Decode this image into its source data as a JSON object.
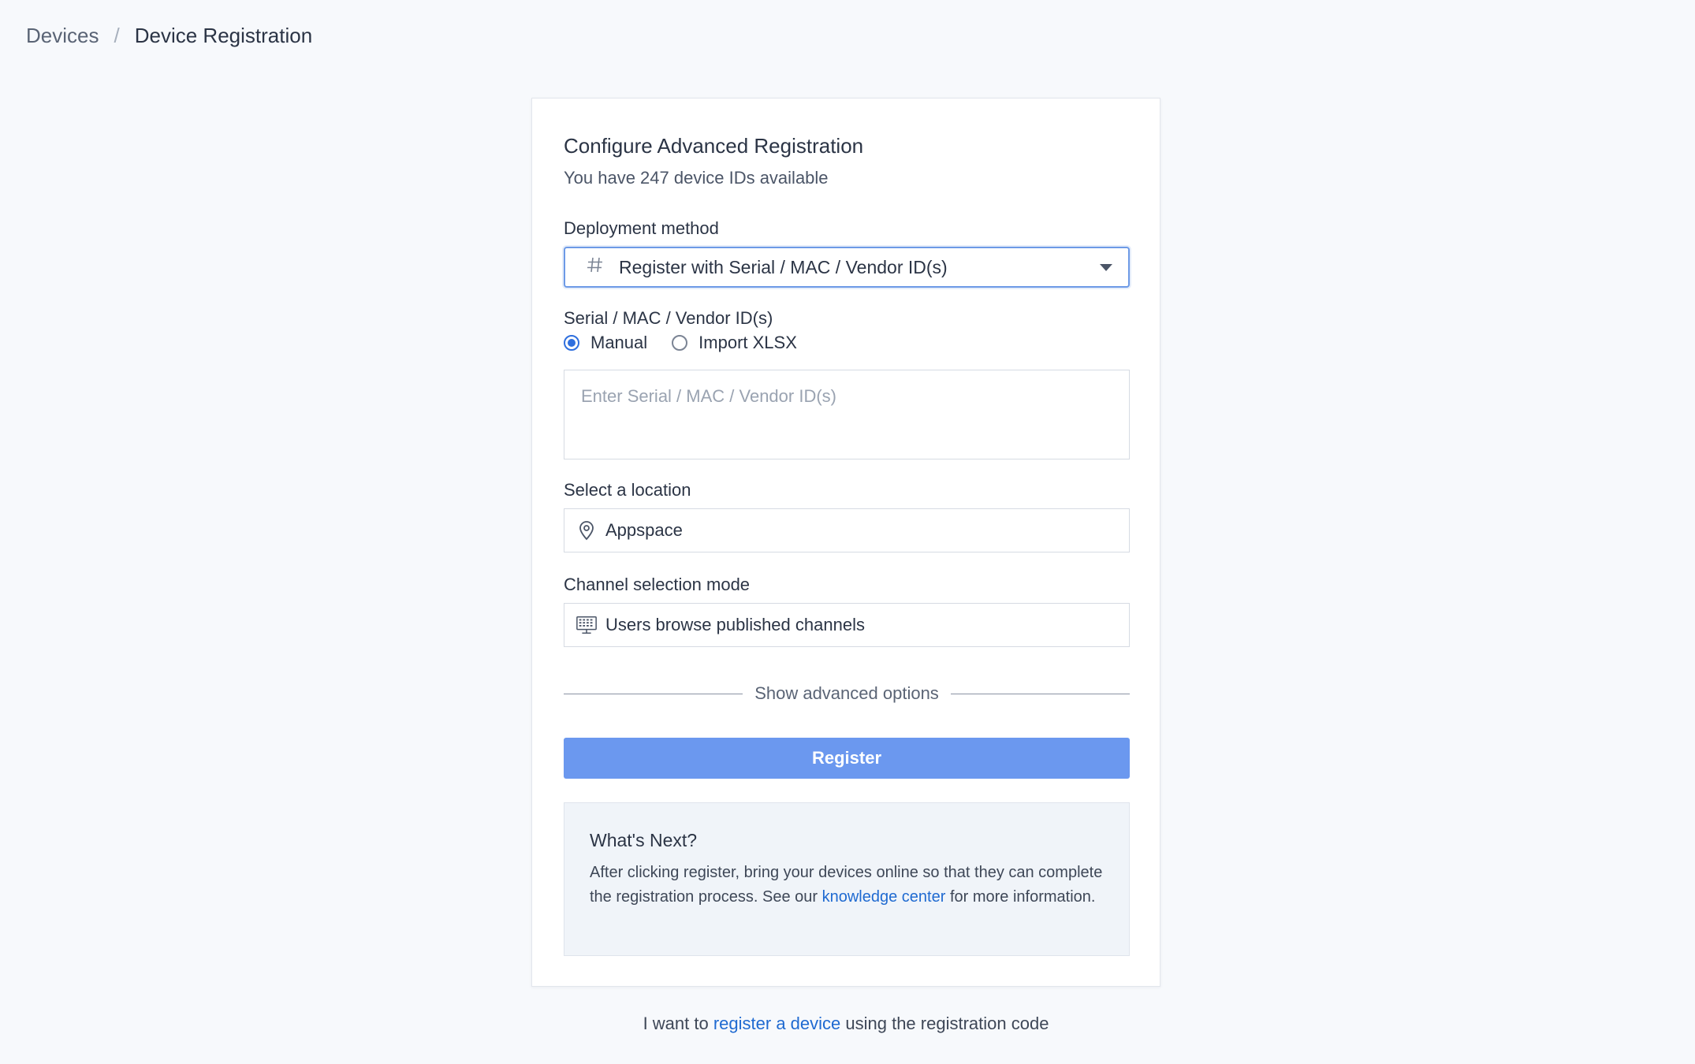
{
  "breadcrumb": {
    "parent": "Devices",
    "separator": "/",
    "current": "Device Registration"
  },
  "form": {
    "title": "Configure Advanced Registration",
    "subtitle": "You have 247 device IDs available",
    "deployment": {
      "label": "Deployment method",
      "icon": "hash-icon",
      "value": "Register with Serial / MAC / Vendor ID(s)"
    },
    "ids": {
      "label": "Serial / MAC / Vendor ID(s)",
      "options": [
        {
          "label": "Manual",
          "checked": true
        },
        {
          "label": "Import XLSX",
          "checked": false
        }
      ],
      "placeholder": "Enter Serial / MAC / Vendor ID(s)",
      "value": ""
    },
    "location": {
      "label": "Select a location",
      "icon": "location-pin-icon",
      "value": "Appspace"
    },
    "channel": {
      "label": "Channel selection mode",
      "icon": "monitor-grid-icon",
      "value": "Users browse published channels"
    },
    "advanced_label": "Show advanced options",
    "register_label": "Register"
  },
  "next": {
    "title": "What's Next?",
    "text_before": "After clicking register, bring your devices online so that they can complete the registration process. See our ",
    "link": "knowledge center",
    "text_after": " for more information."
  },
  "footer": {
    "before": "I want to ",
    "link": "register a device",
    "after": " using the registration code"
  },
  "colors": {
    "accent": "#2f6fde",
    "button": "#6b98ef",
    "link": "#1f6ad1",
    "background": "#f7f9fc"
  }
}
